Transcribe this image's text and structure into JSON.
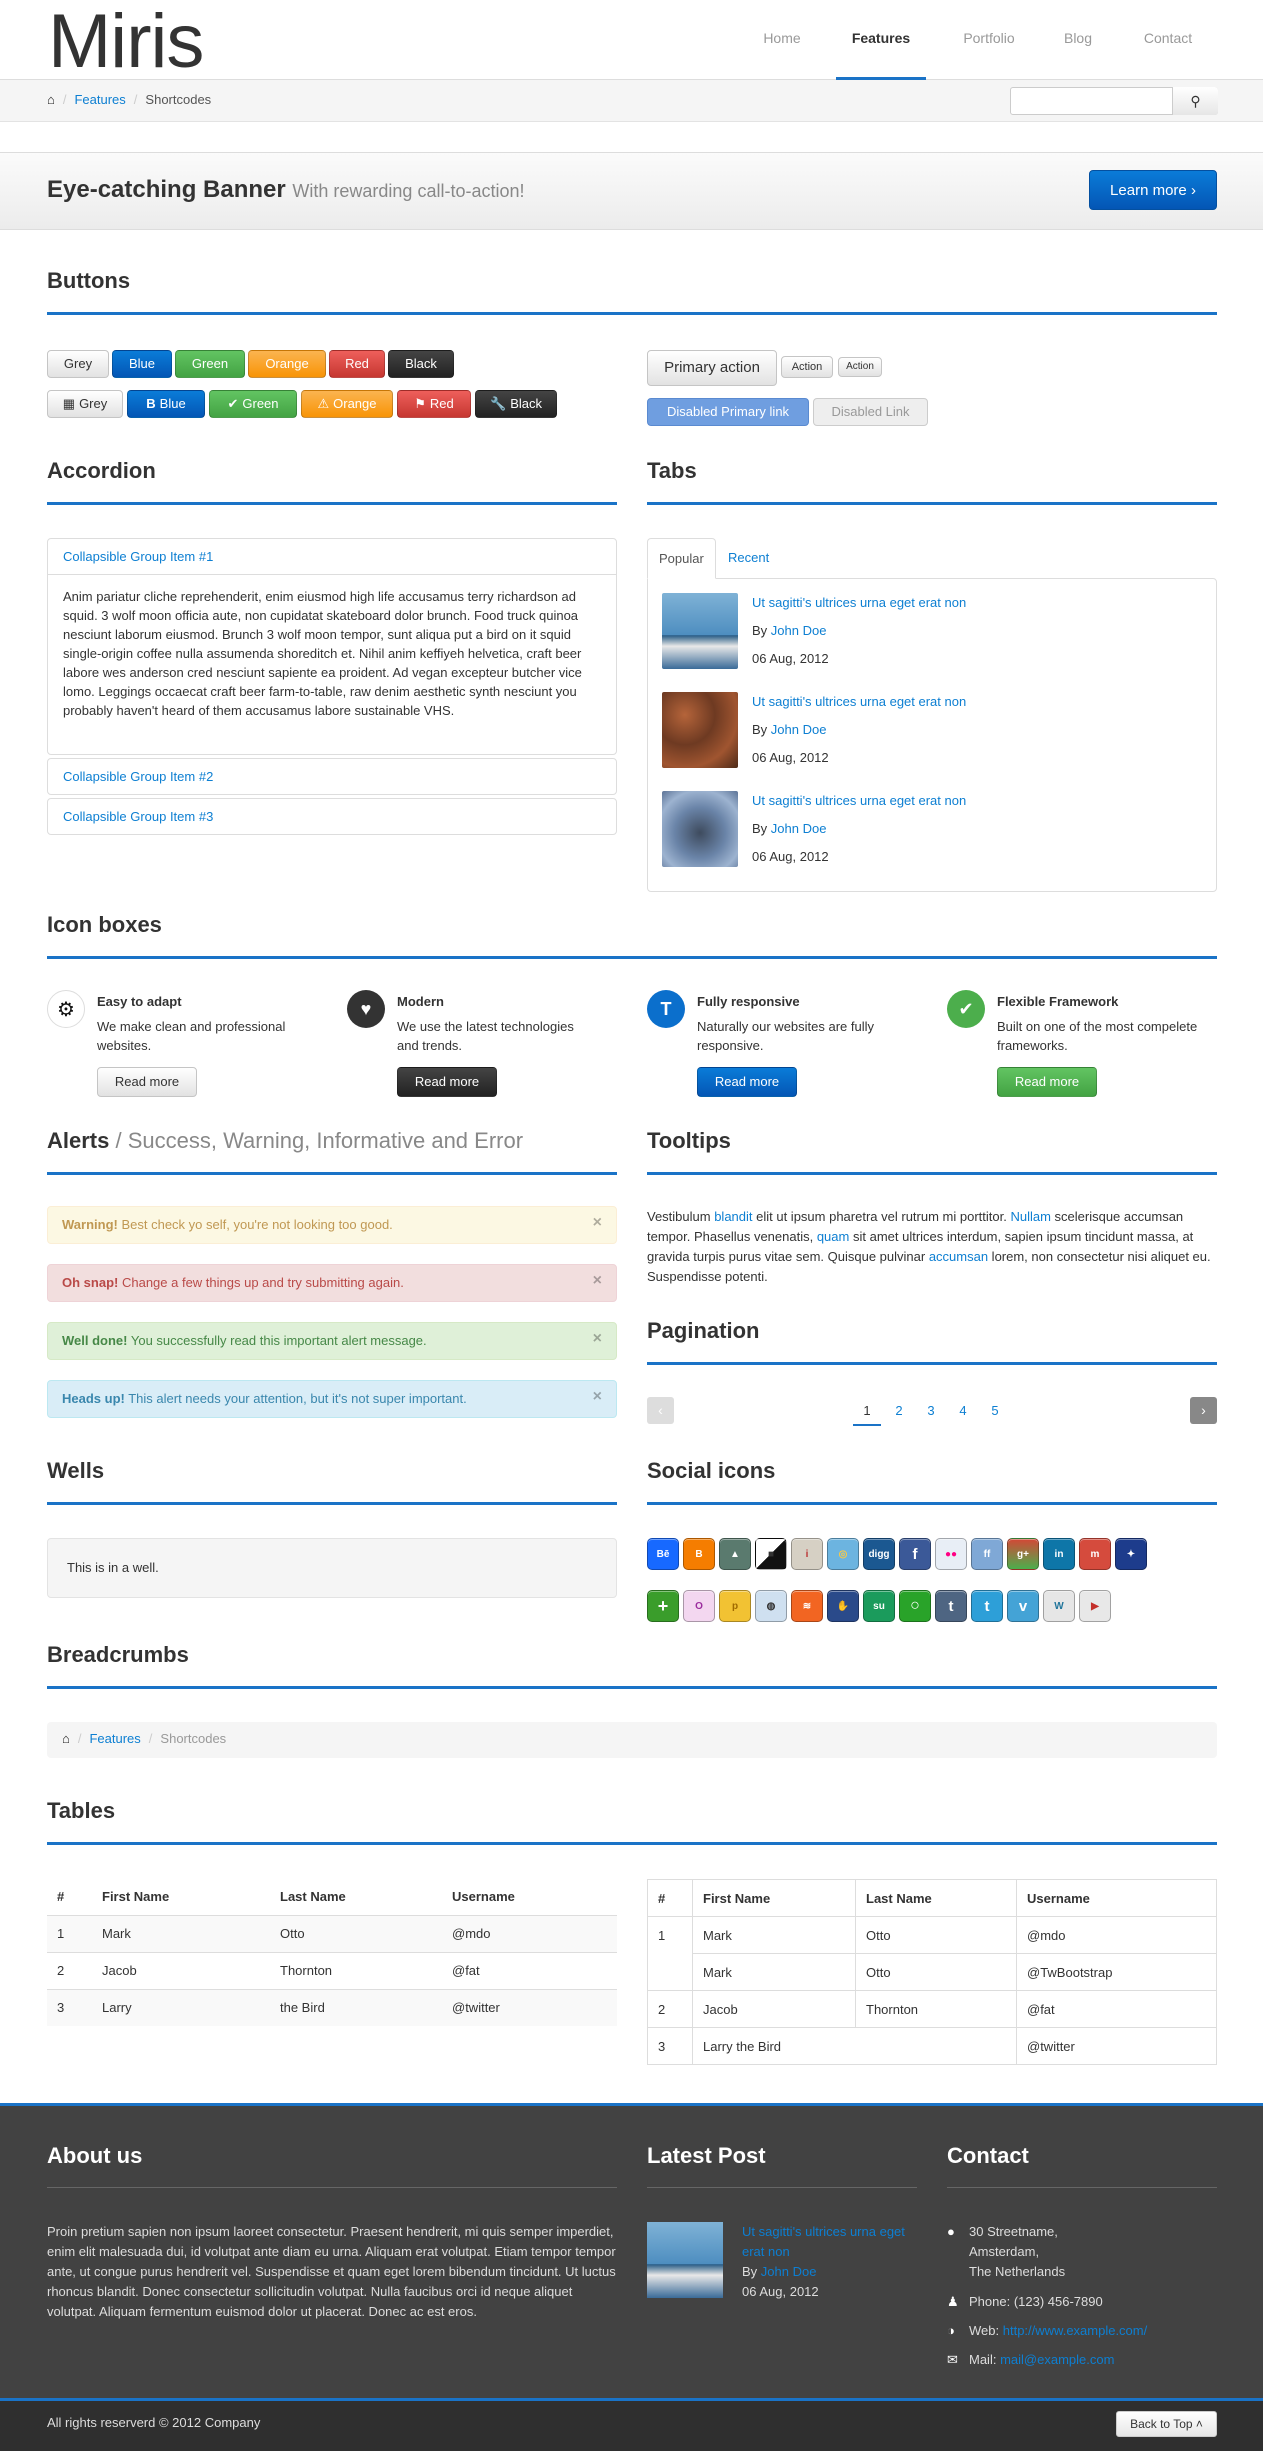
{
  "header": {
    "logo": "Miris",
    "nav": [
      "Home",
      "Features",
      "Portfolio",
      "Blog",
      "Contact"
    ],
    "active_nav": "Features"
  },
  "breadcrumb": {
    "home_icon": "home-icon",
    "items": [
      "Features",
      "Shortcodes"
    ]
  },
  "search": {
    "placeholder": "",
    "button_icon": "search-icon"
  },
  "banner": {
    "title": "Eye-catching Banner",
    "subtitle": "With rewarding call-to-action!",
    "button": "Learn more"
  },
  "buttons": {
    "title": "Buttons",
    "row1": [
      "Grey",
      "Blue",
      "Green",
      "Orange",
      "Red",
      "Black"
    ],
    "row2": [
      "Grey",
      "Blue",
      "Green",
      "Orange",
      "Red",
      "Black"
    ],
    "primary_action": "Primary action",
    "action1": "Action",
    "action2": "Action",
    "disabled_primary": "Disabled Primary link",
    "disabled_link": "Disabled Link"
  },
  "accordion": {
    "title": "Accordion",
    "items": [
      "Collapsible Group Item #1",
      "Collapsible Group Item #2",
      "Collapsible Group Item #3"
    ],
    "body": "Anim pariatur cliche reprehenderit, enim eiusmod high life accusamus terry richardson ad squid. 3 wolf moon officia aute, non cupidatat skateboard dolor brunch. Food truck quinoa nesciunt laborum eiusmod. Brunch 3 wolf moon tempor, sunt aliqua put a bird on it squid single-origin coffee nulla assumenda shoreditch et. Nihil anim keffiyeh helvetica, craft beer labore wes anderson cred nesciunt sapiente ea proident. Ad vegan excepteur butcher vice lomo. Leggings occaecat craft beer farm-to-table, raw denim aesthetic synth nesciunt you probably haven't heard of them accusamus labore sustainable VHS."
  },
  "tabs": {
    "title": "Tabs",
    "labels": [
      "Popular",
      "Recent"
    ],
    "posts": [
      {
        "title": "Ut sagitti's ultrices urna eget erat non",
        "by": "By",
        "author": "John Doe",
        "date": "06 Aug, 2012"
      },
      {
        "title": "Ut sagitti's ultrices urna eget erat non",
        "by": "By",
        "author": "John Doe",
        "date": "06 Aug, 2012"
      },
      {
        "title": "Ut sagitti's ultrices urna eget erat non",
        "by": "By",
        "author": "John Doe",
        "date": "06 Aug, 2012"
      }
    ]
  },
  "iconboxes": {
    "title": "Icon boxes",
    "items": [
      {
        "title": "Easy to adapt",
        "text": "We make clean and professional websites.",
        "button": "Read more",
        "icon": "gear-icon"
      },
      {
        "title": "Modern",
        "text": "We use the latest technologies and trends.",
        "button": "Read more",
        "icon": "heart-icon"
      },
      {
        "title": "Fully responsive",
        "text": "Naturally our websites are fully responsive.",
        "button": "Read more",
        "icon": "text-icon"
      },
      {
        "title": "Flexible Framework",
        "text": "Built on one of the most compelete frameworks.",
        "button": "Read more",
        "icon": "check-icon"
      }
    ]
  },
  "alerts": {
    "title": "Alerts",
    "subtitle": "/ Success, Warning, Informative and Error",
    "items": [
      {
        "strong": "Warning!",
        "text": "Best check yo self, you're not looking too good."
      },
      {
        "strong": "Oh snap!",
        "text": "Change a few things up and try submitting again."
      },
      {
        "strong": "Well done!",
        "text": "You successfully read this important alert message."
      },
      {
        "strong": "Heads up!",
        "text": "This alert needs your attention, but it's not super important."
      }
    ],
    "close": "×"
  },
  "tooltips": {
    "title": "Tooltips",
    "parts": [
      "Vestibulum ",
      "blandit",
      " elit ut ipsum pharetra vel rutrum mi porttitor. ",
      "Nullam",
      " scelerisque accumsan tempor. Phasellus venenatis, ",
      "quam",
      " sit amet ultrices interdum, sapien ipsum tincidunt massa, at gravida turpis purus vitae sem. Quisque pulvinar ",
      "accumsan",
      " lorem, non consectetur nisi aliquet eu. Suspendisse potenti."
    ]
  },
  "pagination": {
    "title": "Pagination",
    "pages": [
      "1",
      "2",
      "3",
      "4",
      "5"
    ],
    "current": "1"
  },
  "wells": {
    "title": "Wells",
    "text": "This is in a well."
  },
  "social": {
    "title": "Social icons",
    "row1": [
      "Bē",
      "B",
      "▲",
      "■",
      "i",
      "◎",
      "digg",
      "f",
      "●●",
      "ff",
      "g+",
      "in",
      "m",
      "✦"
    ],
    "row2": [
      "+",
      "O",
      "p",
      "◍",
      "≋",
      "✋",
      "su",
      "○",
      "t",
      "t",
      "v",
      "W",
      "▶"
    ]
  },
  "breadcrumbs_section": {
    "title": "Breadcrumbs",
    "items": [
      "Features",
      "Shortcodes"
    ]
  },
  "tables": {
    "title": "Tables",
    "headers": [
      "#",
      "First Name",
      "Last Name",
      "Username"
    ],
    "rows1": [
      [
        "1",
        "Mark",
        "Otto",
        "@mdo"
      ],
      [
        "2",
        "Jacob",
        "Thornton",
        "@fat"
      ],
      [
        "3",
        "Larry",
        "the Bird",
        "@twitter"
      ]
    ],
    "rows2": [
      [
        "1",
        "Mark",
        "Otto",
        "@mdo"
      ],
      [
        "",
        "Mark",
        "Otto",
        "@TwBootstrap"
      ],
      [
        "2",
        "Jacob",
        "Thornton",
        "@fat"
      ],
      [
        "3",
        "Larry the Bird",
        "",
        "@twitter"
      ]
    ]
  },
  "footer": {
    "about_title": "About us",
    "about_text": "Proin pretium sapien non ipsum laoreet consectetur. Praesent hendrerit, mi quis semper imperdiet, enim elit malesuada dui, id volutpat ante diam eu urna. Aliquam erat volutpat. Etiam tempor tempor ante, ut congue purus hendrerit vel. Suspendisse et quam eget lorem bibendum tincidunt. Ut luctus rhoncus blandit. Donec consectetur sollicitudin volutpat. Nulla faucibus orci id neque aliquet volutpat. Aliquam fermentum euismod dolor ut placerat. Donec ac est eros.",
    "latest_title": "Latest Post",
    "latest": {
      "title": "Ut sagitti's ultrices urna eget erat non",
      "by": "By",
      "author": "John Doe",
      "date": "06 Aug, 2012"
    },
    "contact_title": "Contact",
    "address": [
      "30 Streetname,",
      "Amsterdam,",
      "The Netherlands"
    ],
    "phone": "Phone: (123) 456-7890",
    "web_label": "Web:",
    "web": "http://www.example.com/",
    "mail_label": "Mail:",
    "mail": "mail@example.com",
    "copyright": "All rights reserverd © 2012 Company",
    "back_to_top": "Back to Top"
  }
}
